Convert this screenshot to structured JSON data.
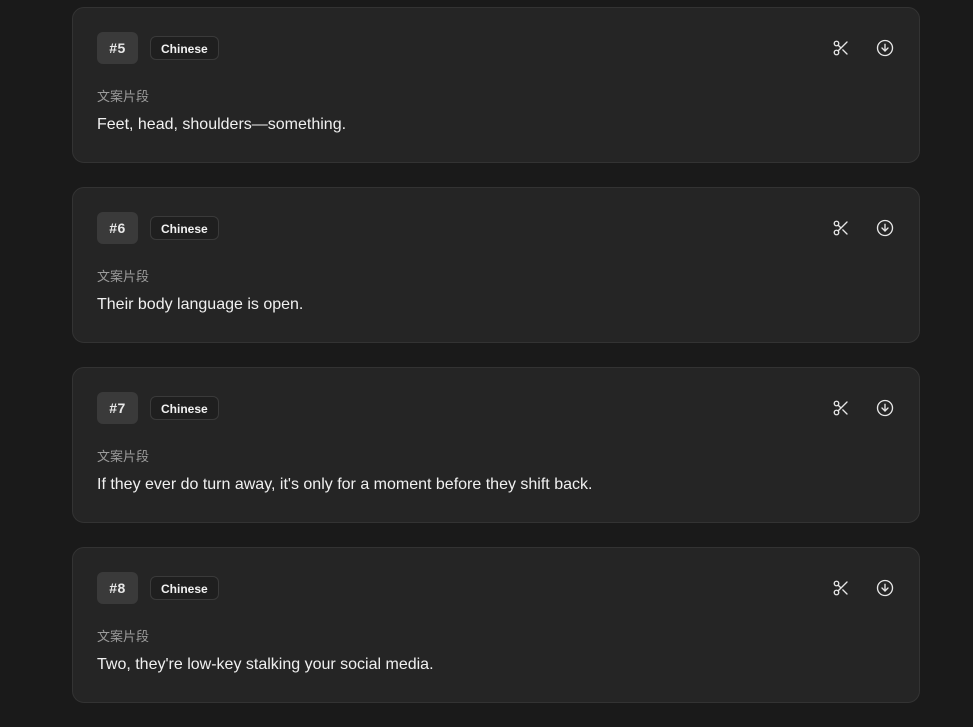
{
  "segments": [
    {
      "number": "#5",
      "language": "Chinese",
      "label": "文案片段",
      "text": "Feet, head, shoulders—something.",
      "actions": {
        "cut_icon": "scissors-icon",
        "download_icon": "download-circle-icon"
      }
    },
    {
      "number": "#6",
      "language": "Chinese",
      "label": "文案片段",
      "text": "Their body language is open.",
      "actions": {
        "cut_icon": "scissors-icon",
        "download_icon": "download-circle-icon"
      }
    },
    {
      "number": "#7",
      "language": "Chinese",
      "label": "文案片段",
      "text": "If they ever do turn away, it's only for a moment before they shift back.",
      "actions": {
        "cut_icon": "scissors-icon",
        "download_icon": "download-circle-icon"
      }
    },
    {
      "number": "#8",
      "language": "Chinese",
      "label": "文案片段",
      "text": "Two, they're low-key stalking your social media.",
      "actions": {
        "cut_icon": "scissors-icon",
        "download_icon": "download-circle-icon"
      }
    }
  ],
  "colors": {
    "background": "#1a1a1a",
    "card": "#252525",
    "card_border": "#333333",
    "text_primary": "#f0f0f0",
    "text_muted": "#9b9b9b"
  }
}
